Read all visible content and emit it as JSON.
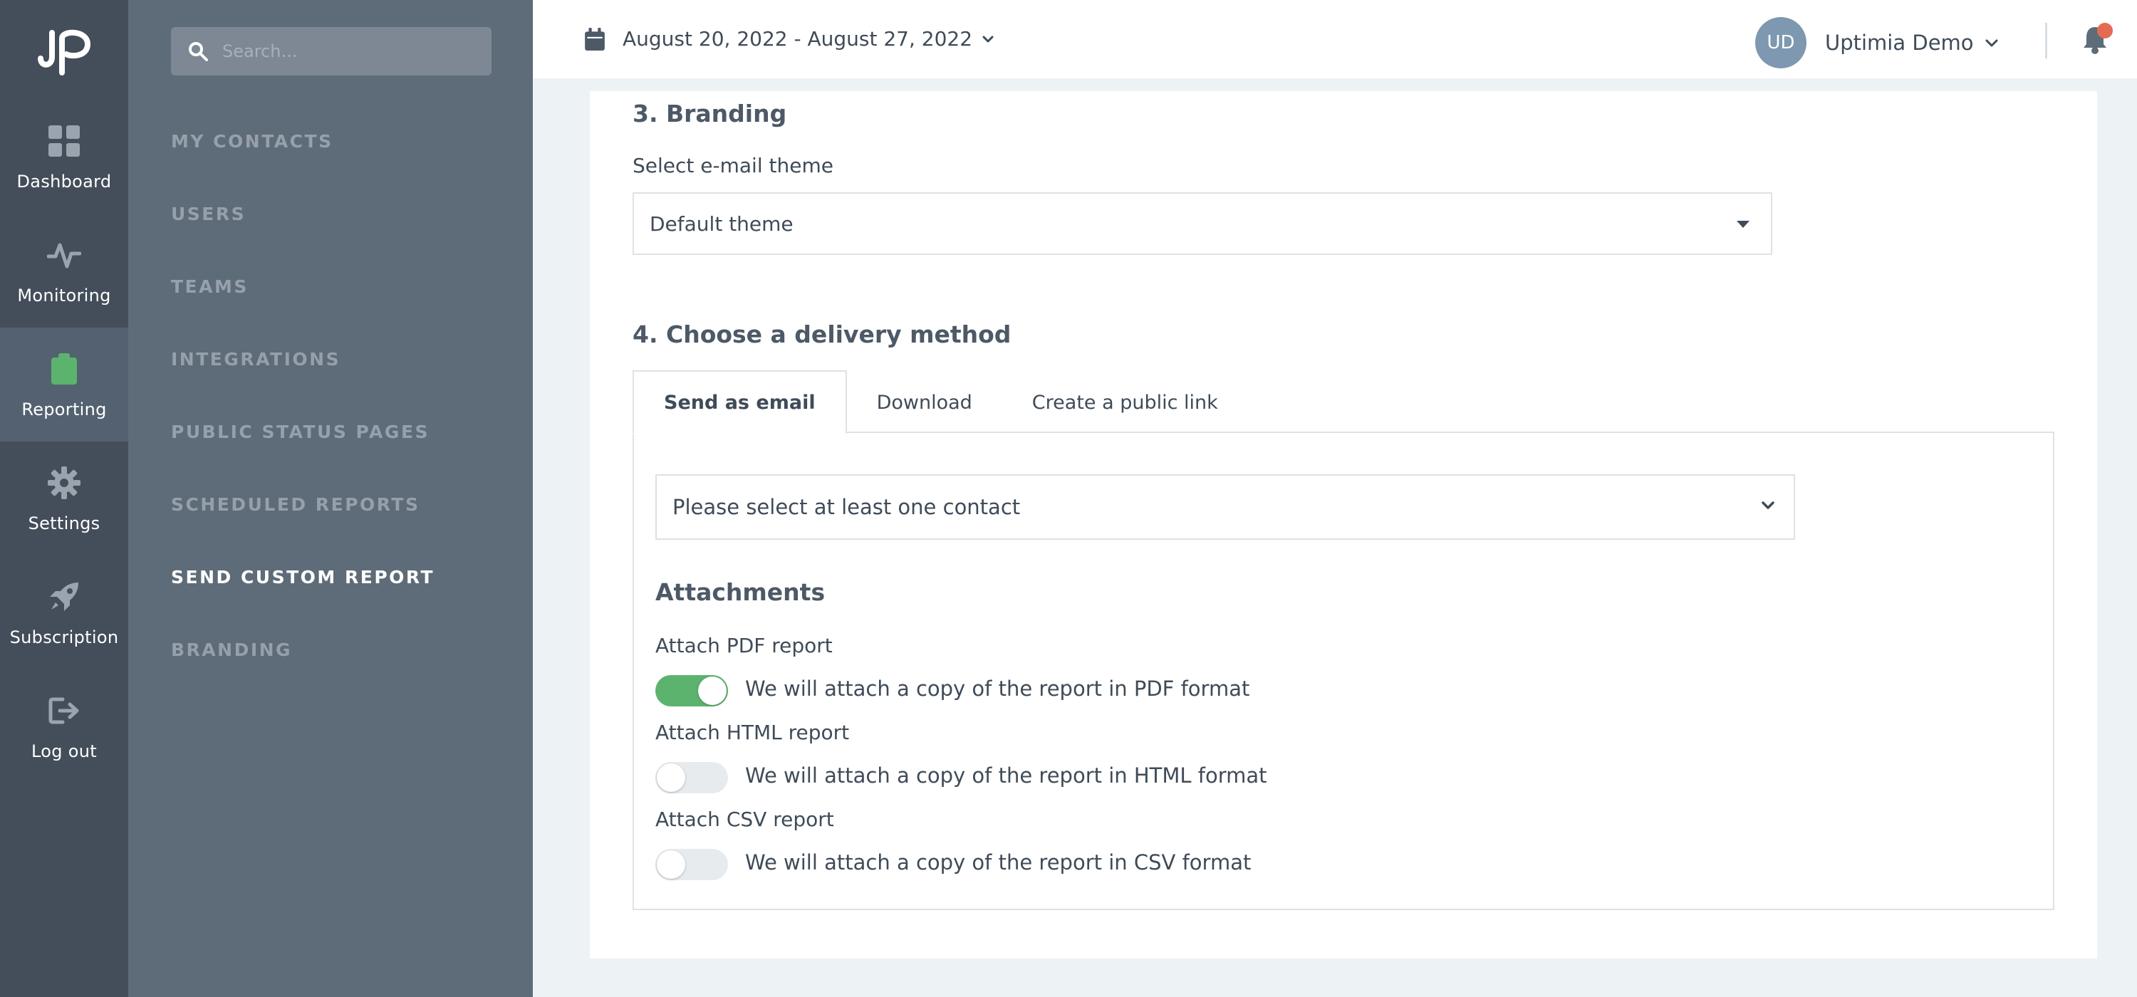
{
  "rail": {
    "items": [
      {
        "label": "Dashboard",
        "icon": "dashboard-grid-icon"
      },
      {
        "label": "Monitoring",
        "icon": "pulse-icon"
      },
      {
        "label": "Reporting",
        "icon": "clipboard-icon",
        "active": true
      },
      {
        "label": "Settings",
        "icon": "gear-icon"
      },
      {
        "label": "Subscription",
        "icon": "rocket-icon"
      },
      {
        "label": "Log out",
        "icon": "logout-icon"
      }
    ]
  },
  "subnav": {
    "search_placeholder": "Search...",
    "items": [
      "MY CONTACTS",
      "USERS",
      "TEAMS",
      "INTEGRATIONS",
      "PUBLIC STATUS PAGES",
      "SCHEDULED REPORTS",
      "SEND CUSTOM REPORT",
      "BRANDING"
    ],
    "active": "SEND CUSTOM REPORT"
  },
  "topbar": {
    "date_range": "August 20, 2022 - August 27, 2022",
    "user_initials": "UD",
    "user_name": "Uptimia Demo"
  },
  "branding": {
    "heading": "3. Branding",
    "theme_label": "Select e-mail theme",
    "theme_value": "Default theme"
  },
  "delivery": {
    "heading": "4. Choose a delivery method",
    "tabs": [
      "Send as email",
      "Download",
      "Create a public link"
    ],
    "active_tab": "Send as email",
    "contact_placeholder": "Please select at least one contact",
    "attachments_heading": "Attachments",
    "attachments": [
      {
        "label": "Attach PDF report",
        "description": "We will attach a copy of the report in PDF format",
        "enabled": true
      },
      {
        "label": "Attach HTML report",
        "description": "We will attach a copy of the report in HTML format",
        "enabled": false
      },
      {
        "label": "Attach CSV report",
        "description": "We will attach a copy of the report in CSV format",
        "enabled": false
      }
    ]
  },
  "colors": {
    "accent_green": "#5cb36e",
    "notification_dot": "#e56a54",
    "rail_bg": "#434e5a",
    "subnav_bg": "#5e6b78"
  }
}
